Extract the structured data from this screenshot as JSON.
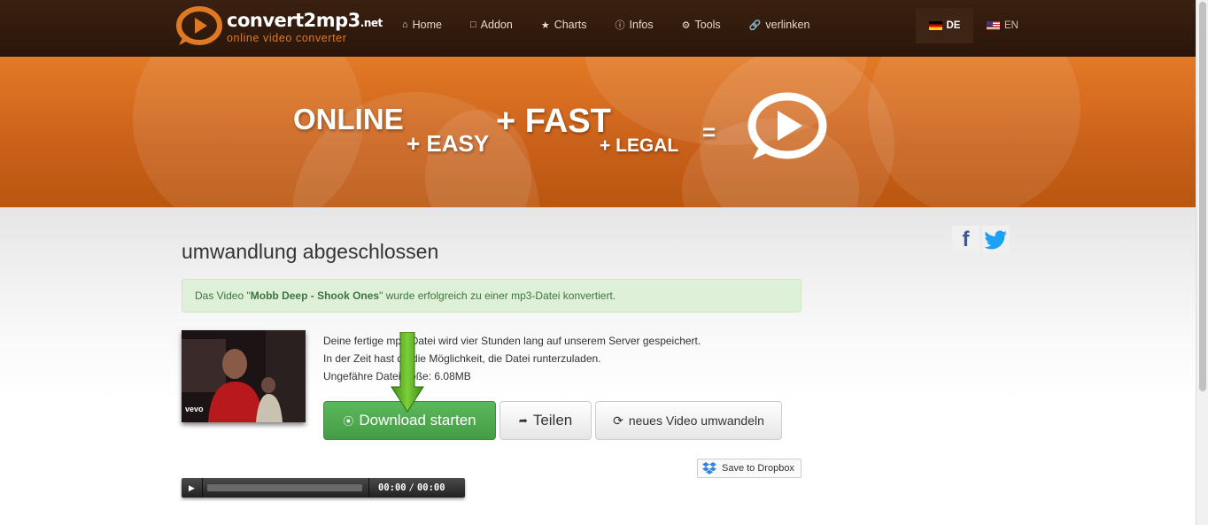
{
  "logo": {
    "name": "convert2mp3",
    "tld": ".net",
    "tagline": "online video converter"
  },
  "nav": [
    {
      "label": "Home",
      "icon": "home-icon"
    },
    {
      "label": "Addon",
      "icon": "document-icon"
    },
    {
      "label": "Charts",
      "icon": "star-icon"
    },
    {
      "label": "Infos",
      "icon": "info-icon"
    },
    {
      "label": "Tools",
      "icon": "gears-icon"
    },
    {
      "label": "verlinken",
      "icon": "link-icon"
    }
  ],
  "languages": {
    "de": "DE",
    "en": "EN"
  },
  "hero": {
    "online": "ONLINE",
    "easy": "+ EASY",
    "fast": "+ FAST",
    "legal": "+ LEGAL",
    "equals": "="
  },
  "page_title": "umwandlung abgeschlossen",
  "alert": {
    "prefix": "Das Video \"",
    "title": "Mobb Deep - Shook Ones",
    "suffix": "\" wurde erfolgreich zu einer mp3-Datei konvertiert."
  },
  "thumbnail": {
    "watermark": "vevo"
  },
  "info": {
    "line1": "Deine fertige mp3-Datei wird vier Stunden lang auf unserem Server gespeichert.",
    "line2": "In der Zeit hast du die Möglichkeit, die Datei runterzuladen.",
    "line3": "Ungefähre Dateigröße: 6.08MB"
  },
  "buttons": {
    "download": "Download starten",
    "share": "Teilen",
    "new_video": "neues Video umwandeln",
    "dropbox": "Save to Dropbox"
  },
  "player": {
    "current": "00:00",
    "duration": "00:00",
    "progress": 0
  },
  "colors": {
    "brand_orange": "#e37a26",
    "nav_bg": "#2a160a",
    "success": "#5cb85c",
    "alert_bg": "#dff0d8"
  }
}
